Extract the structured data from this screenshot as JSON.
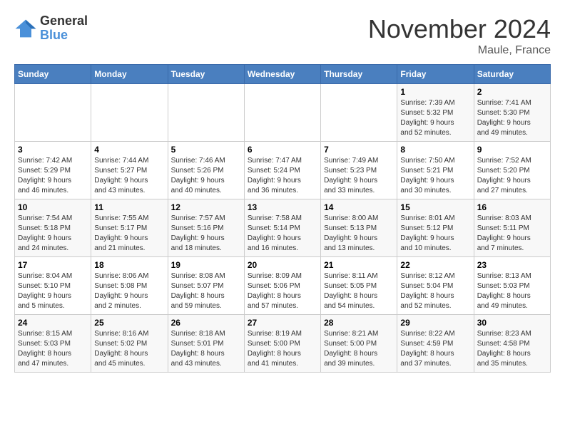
{
  "logo": {
    "line1": "General",
    "line2": "Blue"
  },
  "header": {
    "title": "November 2024",
    "location": "Maule, France"
  },
  "columns": [
    "Sunday",
    "Monday",
    "Tuesday",
    "Wednesday",
    "Thursday",
    "Friday",
    "Saturday"
  ],
  "weeks": [
    [
      {
        "day": "",
        "info": ""
      },
      {
        "day": "",
        "info": ""
      },
      {
        "day": "",
        "info": ""
      },
      {
        "day": "",
        "info": ""
      },
      {
        "day": "",
        "info": ""
      },
      {
        "day": "1",
        "info": "Sunrise: 7:39 AM\nSunset: 5:32 PM\nDaylight: 9 hours\nand 52 minutes."
      },
      {
        "day": "2",
        "info": "Sunrise: 7:41 AM\nSunset: 5:30 PM\nDaylight: 9 hours\nand 49 minutes."
      }
    ],
    [
      {
        "day": "3",
        "info": "Sunrise: 7:42 AM\nSunset: 5:29 PM\nDaylight: 9 hours\nand 46 minutes."
      },
      {
        "day": "4",
        "info": "Sunrise: 7:44 AM\nSunset: 5:27 PM\nDaylight: 9 hours\nand 43 minutes."
      },
      {
        "day": "5",
        "info": "Sunrise: 7:46 AM\nSunset: 5:26 PM\nDaylight: 9 hours\nand 40 minutes."
      },
      {
        "day": "6",
        "info": "Sunrise: 7:47 AM\nSunset: 5:24 PM\nDaylight: 9 hours\nand 36 minutes."
      },
      {
        "day": "7",
        "info": "Sunrise: 7:49 AM\nSunset: 5:23 PM\nDaylight: 9 hours\nand 33 minutes."
      },
      {
        "day": "8",
        "info": "Sunrise: 7:50 AM\nSunset: 5:21 PM\nDaylight: 9 hours\nand 30 minutes."
      },
      {
        "day": "9",
        "info": "Sunrise: 7:52 AM\nSunset: 5:20 PM\nDaylight: 9 hours\nand 27 minutes."
      }
    ],
    [
      {
        "day": "10",
        "info": "Sunrise: 7:54 AM\nSunset: 5:18 PM\nDaylight: 9 hours\nand 24 minutes."
      },
      {
        "day": "11",
        "info": "Sunrise: 7:55 AM\nSunset: 5:17 PM\nDaylight: 9 hours\nand 21 minutes."
      },
      {
        "day": "12",
        "info": "Sunrise: 7:57 AM\nSunset: 5:16 PM\nDaylight: 9 hours\nand 18 minutes."
      },
      {
        "day": "13",
        "info": "Sunrise: 7:58 AM\nSunset: 5:14 PM\nDaylight: 9 hours\nand 16 minutes."
      },
      {
        "day": "14",
        "info": "Sunrise: 8:00 AM\nSunset: 5:13 PM\nDaylight: 9 hours\nand 13 minutes."
      },
      {
        "day": "15",
        "info": "Sunrise: 8:01 AM\nSunset: 5:12 PM\nDaylight: 9 hours\nand 10 minutes."
      },
      {
        "day": "16",
        "info": "Sunrise: 8:03 AM\nSunset: 5:11 PM\nDaylight: 9 hours\nand 7 minutes."
      }
    ],
    [
      {
        "day": "17",
        "info": "Sunrise: 8:04 AM\nSunset: 5:10 PM\nDaylight: 9 hours\nand 5 minutes."
      },
      {
        "day": "18",
        "info": "Sunrise: 8:06 AM\nSunset: 5:08 PM\nDaylight: 9 hours\nand 2 minutes."
      },
      {
        "day": "19",
        "info": "Sunrise: 8:08 AM\nSunset: 5:07 PM\nDaylight: 8 hours\nand 59 minutes."
      },
      {
        "day": "20",
        "info": "Sunrise: 8:09 AM\nSunset: 5:06 PM\nDaylight: 8 hours\nand 57 minutes."
      },
      {
        "day": "21",
        "info": "Sunrise: 8:11 AM\nSunset: 5:05 PM\nDaylight: 8 hours\nand 54 minutes."
      },
      {
        "day": "22",
        "info": "Sunrise: 8:12 AM\nSunset: 5:04 PM\nDaylight: 8 hours\nand 52 minutes."
      },
      {
        "day": "23",
        "info": "Sunrise: 8:13 AM\nSunset: 5:03 PM\nDaylight: 8 hours\nand 49 minutes."
      }
    ],
    [
      {
        "day": "24",
        "info": "Sunrise: 8:15 AM\nSunset: 5:03 PM\nDaylight: 8 hours\nand 47 minutes."
      },
      {
        "day": "25",
        "info": "Sunrise: 8:16 AM\nSunset: 5:02 PM\nDaylight: 8 hours\nand 45 minutes."
      },
      {
        "day": "26",
        "info": "Sunrise: 8:18 AM\nSunset: 5:01 PM\nDaylight: 8 hours\nand 43 minutes."
      },
      {
        "day": "27",
        "info": "Sunrise: 8:19 AM\nSunset: 5:00 PM\nDaylight: 8 hours\nand 41 minutes."
      },
      {
        "day": "28",
        "info": "Sunrise: 8:21 AM\nSunset: 5:00 PM\nDaylight: 8 hours\nand 39 minutes."
      },
      {
        "day": "29",
        "info": "Sunrise: 8:22 AM\nSunset: 4:59 PM\nDaylight: 8 hours\nand 37 minutes."
      },
      {
        "day": "30",
        "info": "Sunrise: 8:23 AM\nSunset: 4:58 PM\nDaylight: 8 hours\nand 35 minutes."
      }
    ]
  ]
}
